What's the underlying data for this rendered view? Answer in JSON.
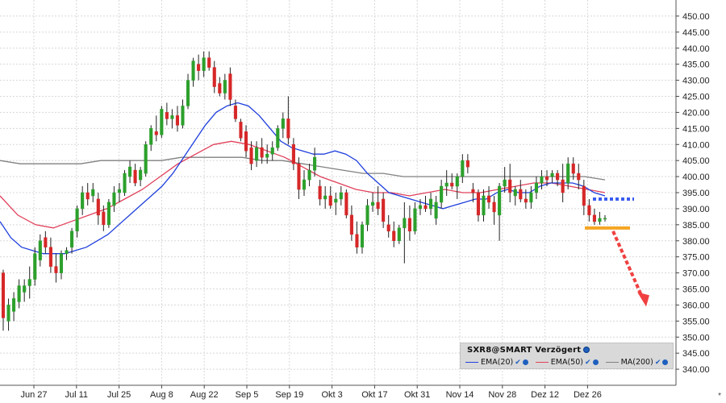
{
  "chart_data": {
    "type": "candlestick",
    "symbol": "SXR8@SMART Verzögert",
    "ylim": [
      335,
      455
    ],
    "y_ticks": [
      "340.00",
      "345.00",
      "350.00",
      "355.00",
      "360.00",
      "365.00",
      "370.00",
      "375.00",
      "380.00",
      "385.00",
      "390.00",
      "395.00",
      "400.00",
      "405.00",
      "410.00",
      "415.00",
      "420.00",
      "425.00",
      "430.00",
      "435.00",
      "440.00",
      "445.00",
      "450.00"
    ],
    "x_ticks": [
      "Jun 27",
      "Jul 11",
      "Jul 25",
      "Aug 8",
      "Aug 22",
      "Sep 5",
      "Sep 19",
      "Okt 3",
      "Okt 17",
      "Okt 31",
      "Nov 14",
      "Nov 28",
      "Dez 12",
      "Dez 26"
    ],
    "grid": true,
    "legend_placement": "bottom-right",
    "colors": {
      "up": "#2ca02c",
      "down": "#d62728",
      "ema20": "#1f3fdc",
      "ema50": "#e0405a",
      "ma200": "#808080",
      "resistance": "#3a5cf0",
      "support": "#f5a623",
      "forecast_arrow": "#f04040",
      "grid": "#d8d8d8"
    },
    "series": [
      {
        "name": "EMA(20)",
        "color": "#1f3fdc"
      },
      {
        "name": "EMA(50)",
        "color": "#e0405a"
      },
      {
        "name": "MA(200)",
        "color": "#808080"
      }
    ],
    "candles": [
      {
        "o": 370,
        "h": 371,
        "l": 352,
        "c": 356
      },
      {
        "o": 355,
        "h": 362,
        "l": 352,
        "c": 360
      },
      {
        "o": 358,
        "h": 364,
        "l": 355,
        "c": 362
      },
      {
        "o": 361,
        "h": 368,
        "l": 359,
        "c": 366
      },
      {
        "o": 364,
        "h": 368,
        "l": 361,
        "c": 366
      },
      {
        "o": 366,
        "h": 372,
        "l": 362,
        "c": 368
      },
      {
        "o": 368,
        "h": 378,
        "l": 366,
        "c": 376
      },
      {
        "o": 374,
        "h": 382,
        "l": 372,
        "c": 380
      },
      {
        "o": 381,
        "h": 383,
        "l": 376,
        "c": 378
      },
      {
        "o": 378,
        "h": 381,
        "l": 370,
        "c": 372
      },
      {
        "o": 372,
        "h": 376,
        "l": 367,
        "c": 370
      },
      {
        "o": 370,
        "h": 377,
        "l": 368,
        "c": 376
      },
      {
        "o": 376,
        "h": 378,
        "l": 374,
        "c": 377
      },
      {
        "o": 378,
        "h": 384,
        "l": 376,
        "c": 383
      },
      {
        "o": 383,
        "h": 391,
        "l": 381,
        "c": 390
      },
      {
        "o": 390,
        "h": 397,
        "l": 388,
        "c": 395
      },
      {
        "o": 395,
        "h": 398,
        "l": 391,
        "c": 393
      },
      {
        "o": 394,
        "h": 398,
        "l": 392,
        "c": 396
      },
      {
        "o": 393,
        "h": 395,
        "l": 385,
        "c": 388
      },
      {
        "o": 389,
        "h": 391,
        "l": 383,
        "c": 385
      },
      {
        "o": 385,
        "h": 393,
        "l": 384,
        "c": 392
      },
      {
        "o": 391,
        "h": 397,
        "l": 389,
        "c": 395
      },
      {
        "o": 395,
        "h": 398,
        "l": 392,
        "c": 396
      },
      {
        "o": 395,
        "h": 402,
        "l": 394,
        "c": 401
      },
      {
        "o": 400,
        "h": 405,
        "l": 398,
        "c": 403
      },
      {
        "o": 402,
        "h": 404,
        "l": 397,
        "c": 398
      },
      {
        "o": 399,
        "h": 403,
        "l": 397,
        "c": 402
      },
      {
        "o": 401,
        "h": 411,
        "l": 400,
        "c": 410
      },
      {
        "o": 410,
        "h": 416,
        "l": 408,
        "c": 415
      },
      {
        "o": 414,
        "h": 419,
        "l": 411,
        "c": 413
      },
      {
        "o": 413,
        "h": 422,
        "l": 412,
        "c": 421
      },
      {
        "o": 420,
        "h": 423,
        "l": 416,
        "c": 418
      },
      {
        "o": 418,
        "h": 421,
        "l": 415,
        "c": 419
      },
      {
        "o": 419,
        "h": 422,
        "l": 414,
        "c": 416
      },
      {
        "o": 416,
        "h": 424,
        "l": 415,
        "c": 422
      },
      {
        "o": 422,
        "h": 432,
        "l": 421,
        "c": 430
      },
      {
        "o": 430,
        "h": 437,
        "l": 428,
        "c": 436
      },
      {
        "o": 435,
        "h": 438,
        "l": 430,
        "c": 433
      },
      {
        "o": 433,
        "h": 439,
        "l": 431,
        "c": 437
      },
      {
        "o": 437,
        "h": 439,
        "l": 433,
        "c": 434
      },
      {
        "o": 434,
        "h": 436,
        "l": 426,
        "c": 428
      },
      {
        "o": 429,
        "h": 431,
        "l": 425,
        "c": 426
      },
      {
        "o": 426,
        "h": 432,
        "l": 424,
        "c": 430
      },
      {
        "o": 432,
        "h": 434,
        "l": 422,
        "c": 424
      },
      {
        "o": 422,
        "h": 424,
        "l": 417,
        "c": 418
      },
      {
        "o": 417,
        "h": 418,
        "l": 411,
        "c": 412
      },
      {
        "o": 414,
        "h": 416,
        "l": 406,
        "c": 408
      },
      {
        "o": 409,
        "h": 411,
        "l": 402,
        "c": 404
      },
      {
        "o": 405,
        "h": 411,
        "l": 403,
        "c": 409
      },
      {
        "o": 409,
        "h": 412,
        "l": 404,
        "c": 406
      },
      {
        "o": 406,
        "h": 410,
        "l": 404,
        "c": 407
      },
      {
        "o": 407,
        "h": 411,
        "l": 405,
        "c": 409
      },
      {
        "o": 409,
        "h": 416,
        "l": 408,
        "c": 415
      },
      {
        "o": 415,
        "h": 420,
        "l": 412,
        "c": 418
      },
      {
        "o": 418,
        "h": 425,
        "l": 410,
        "c": 412
      },
      {
        "o": 410,
        "h": 412,
        "l": 402,
        "c": 404
      },
      {
        "o": 404,
        "h": 406,
        "l": 393,
        "c": 396
      },
      {
        "o": 396,
        "h": 402,
        "l": 394,
        "c": 399
      },
      {
        "o": 399,
        "h": 404,
        "l": 397,
        "c": 402
      },
      {
        "o": 402,
        "h": 409,
        "l": 400,
        "c": 406
      },
      {
        "o": 397,
        "h": 399,
        "l": 391,
        "c": 393
      },
      {
        "o": 393,
        "h": 397,
        "l": 390,
        "c": 394
      },
      {
        "o": 394,
        "h": 397,
        "l": 390,
        "c": 391
      },
      {
        "o": 392,
        "h": 395,
        "l": 388,
        "c": 393
      },
      {
        "o": 393,
        "h": 397,
        "l": 391,
        "c": 395
      },
      {
        "o": 395,
        "h": 396,
        "l": 387,
        "c": 388
      },
      {
        "o": 388,
        "h": 391,
        "l": 380,
        "c": 382
      },
      {
        "o": 382,
        "h": 386,
        "l": 376,
        "c": 378
      },
      {
        "o": 378,
        "h": 386,
        "l": 376,
        "c": 385
      },
      {
        "o": 385,
        "h": 393,
        "l": 383,
        "c": 391
      },
      {
        "o": 391,
        "h": 395,
        "l": 389,
        "c": 392
      },
      {
        "o": 392,
        "h": 397,
        "l": 388,
        "c": 390
      },
      {
        "o": 393,
        "h": 395,
        "l": 384,
        "c": 386
      },
      {
        "o": 385,
        "h": 388,
        "l": 381,
        "c": 383
      },
      {
        "o": 383,
        "h": 386,
        "l": 378,
        "c": 380
      },
      {
        "o": 380,
        "h": 385,
        "l": 379,
        "c": 384
      },
      {
        "o": 384,
        "h": 392,
        "l": 373,
        "c": 387
      },
      {
        "o": 387,
        "h": 391,
        "l": 380,
        "c": 383
      },
      {
        "o": 383,
        "h": 392,
        "l": 382,
        "c": 390
      },
      {
        "o": 390,
        "h": 393,
        "l": 388,
        "c": 391
      },
      {
        "o": 391,
        "h": 394,
        "l": 389,
        "c": 390
      },
      {
        "o": 390,
        "h": 395,
        "l": 388,
        "c": 393
      },
      {
        "o": 387,
        "h": 394,
        "l": 385,
        "c": 392
      },
      {
        "o": 392,
        "h": 399,
        "l": 390,
        "c": 397
      },
      {
        "o": 397,
        "h": 402,
        "l": 394,
        "c": 398
      },
      {
        "o": 398,
        "h": 401,
        "l": 396,
        "c": 397
      },
      {
        "o": 397,
        "h": 401,
        "l": 393,
        "c": 400
      },
      {
        "o": 400,
        "h": 407,
        "l": 398,
        "c": 405
      },
      {
        "o": 405,
        "h": 407,
        "l": 401,
        "c": 403
      },
      {
        "o": 396,
        "h": 398,
        "l": 392,
        "c": 395
      },
      {
        "o": 395,
        "h": 396,
        "l": 386,
        "c": 388
      },
      {
        "o": 388,
        "h": 396,
        "l": 386,
        "c": 394
      },
      {
        "o": 394,
        "h": 397,
        "l": 390,
        "c": 392
      },
      {
        "o": 392,
        "h": 394,
        "l": 385,
        "c": 389
      },
      {
        "o": 388,
        "h": 398,
        "l": 380,
        "c": 397
      },
      {
        "o": 397,
        "h": 403,
        "l": 395,
        "c": 399
      },
      {
        "o": 399,
        "h": 404,
        "l": 392,
        "c": 395
      },
      {
        "o": 394,
        "h": 397,
        "l": 391,
        "c": 396
      },
      {
        "o": 396,
        "h": 399,
        "l": 392,
        "c": 393
      },
      {
        "o": 393,
        "h": 396,
        "l": 390,
        "c": 392
      },
      {
        "o": 392,
        "h": 397,
        "l": 390,
        "c": 395
      },
      {
        "o": 395,
        "h": 400,
        "l": 393,
        "c": 398
      },
      {
        "o": 398,
        "h": 402,
        "l": 396,
        "c": 400
      },
      {
        "o": 400,
        "h": 402,
        "l": 397,
        "c": 399
      },
      {
        "o": 400,
        "h": 402,
        "l": 398,
        "c": 401
      },
      {
        "o": 401,
        "h": 402,
        "l": 397,
        "c": 399
      },
      {
        "o": 399,
        "h": 404,
        "l": 392,
        "c": 395
      },
      {
        "o": 398,
        "h": 406,
        "l": 396,
        "c": 404
      },
      {
        "o": 404,
        "h": 406,
        "l": 399,
        "c": 401
      },
      {
        "o": 401,
        "h": 404,
        "l": 396,
        "c": 399
      },
      {
        "o": 397,
        "h": 399,
        "l": 388,
        "c": 391
      },
      {
        "o": 391,
        "h": 393,
        "l": 386,
        "c": 388
      },
      {
        "o": 388,
        "h": 390,
        "l": 385,
        "c": 386
      },
      {
        "o": 386,
        "h": 389,
        "l": 385,
        "c": 387
      },
      {
        "o": 387,
        "h": 388,
        "l": 386,
        "c": 387
      }
    ],
    "ema20": [
      386,
      381,
      378,
      377,
      376,
      376,
      376,
      377,
      378,
      380,
      382,
      385,
      388,
      391,
      394,
      397,
      401,
      406,
      411,
      416,
      420,
      422,
      423,
      422,
      419,
      415,
      411,
      409,
      408,
      407,
      407,
      408,
      407,
      405,
      401,
      398,
      395,
      394,
      393,
      392,
      391,
      390,
      391,
      392,
      393,
      393,
      395,
      396,
      395,
      395,
      397,
      398,
      398,
      398,
      397,
      395,
      394
    ],
    "ema50": [
      394,
      388,
      385,
      384,
      386,
      388,
      390,
      393,
      396,
      400,
      404,
      407,
      410,
      411,
      410,
      408,
      406,
      403,
      400,
      398,
      396,
      395,
      395,
      394,
      395,
      396,
      395,
      395,
      396,
      397,
      398,
      398,
      397,
      396,
      395
    ],
    "ma200": [
      405,
      404,
      404,
      404,
      404,
      405,
      405,
      405,
      405,
      406,
      406,
      406,
      406,
      405,
      405,
      404,
      403,
      402,
      401,
      401,
      400,
      400,
      400,
      400,
      400,
      400,
      400,
      400,
      400,
      400,
      399
    ],
    "resistance_level": 393,
    "support_level": 384,
    "forecast_target": 361
  },
  "legend": {
    "title": "SXR8@SMART Verzögert",
    "items": [
      {
        "label": "EMA(20)",
        "color": "#1f3fdc"
      },
      {
        "label": "EMA(50)",
        "color": "#e0405a"
      },
      {
        "label": "MA(200)",
        "color": "#808080"
      }
    ]
  },
  "corner_mark": "*"
}
